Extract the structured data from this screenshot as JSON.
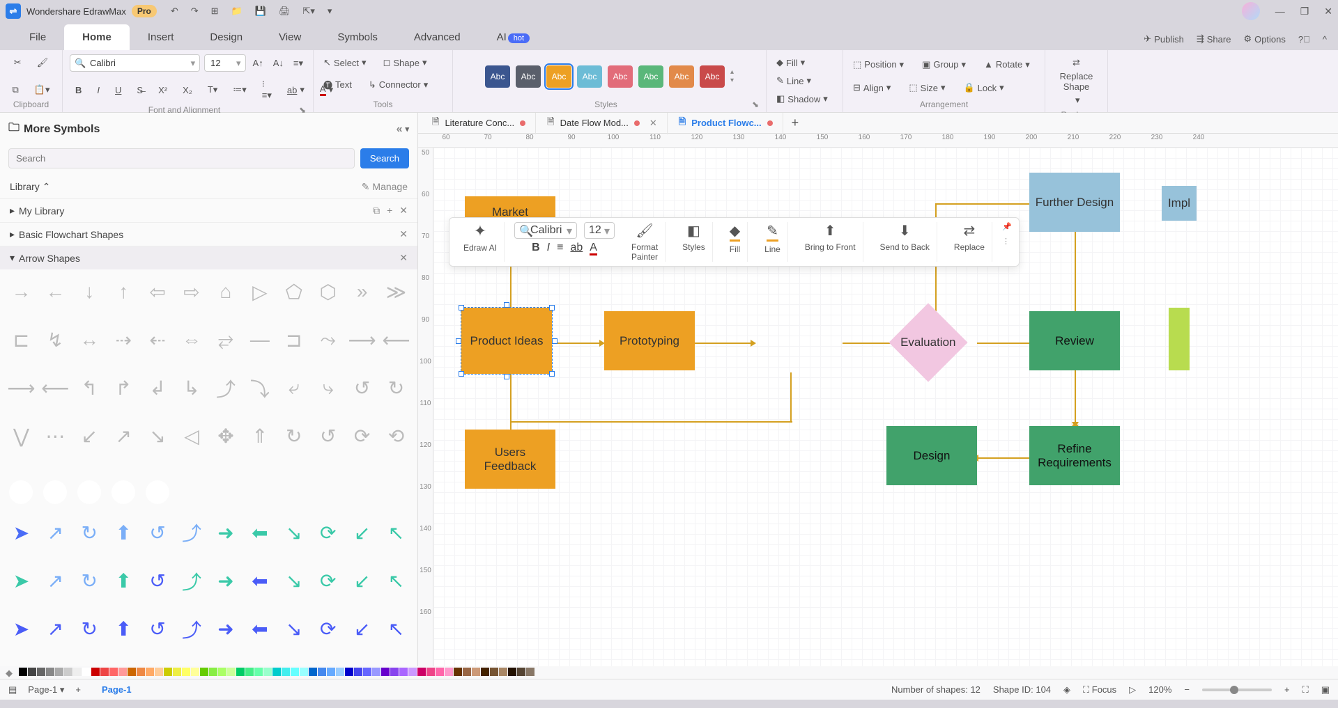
{
  "app": {
    "title": "Wondershare EdrawMax",
    "badge": "Pro"
  },
  "menu": {
    "items": [
      "File",
      "Home",
      "Insert",
      "Design",
      "View",
      "Symbols",
      "Advanced"
    ],
    "ai": "AI",
    "hot": "hot",
    "right": {
      "publish": "Publish",
      "share": "Share",
      "options": "Options"
    }
  },
  "ribbon": {
    "font": {
      "name": "Calibri",
      "size": "12"
    },
    "tools": {
      "select": "Select",
      "text": "Text",
      "shape": "Shape",
      "connector": "Connector"
    },
    "styles_swatches": [
      {
        "bg": "#3b568f",
        "txt": "Abc"
      },
      {
        "bg": "#5a5f6b",
        "txt": "Abc"
      },
      {
        "bg": "#eda023",
        "txt": "Abc",
        "sel": true
      },
      {
        "bg": "#6cbcd6",
        "txt": "Abc"
      },
      {
        "bg": "#e26c7a",
        "txt": "Abc"
      },
      {
        "bg": "#5ab77a",
        "txt": "Abc"
      },
      {
        "bg": "#e28a4a",
        "txt": "Abc"
      },
      {
        "bg": "#c94a4a",
        "txt": "Abc"
      }
    ],
    "shape_fmt": {
      "fill": "Fill",
      "line": "Line",
      "shadow": "Shadow"
    },
    "arrange": {
      "position": "Position",
      "align": "Align",
      "group": "Group",
      "size": "Size",
      "rotate": "Rotate",
      "lock": "Lock"
    },
    "replace": "Replace\nShape",
    "groups": {
      "clipboard": "Clipboard",
      "font": "Font and Alignment",
      "tools": "Tools",
      "styles": "Styles",
      "arrange": "Arrangement",
      "replace": "Replace"
    }
  },
  "side": {
    "title": "More Symbols",
    "search_ph": "Search",
    "search_btn": "Search",
    "library": "Library",
    "manage": "Manage",
    "cats": {
      "mylib": "My Library",
      "basic": "Basic Flowchart Shapes",
      "arrow": "Arrow Shapes"
    }
  },
  "tabs": [
    {
      "label": "Literature Conc...",
      "dirty": true,
      "active": false
    },
    {
      "label": "Date Flow Mod...",
      "dirty": true,
      "active": false,
      "closable": true
    },
    {
      "label": "Product Flowc...",
      "dirty": true,
      "active": true
    }
  ],
  "ruler_h": [
    "60",
    "70",
    "80",
    "90",
    "100",
    "110",
    "120",
    "130",
    "140",
    "150",
    "160",
    "170",
    "180",
    "190",
    "200",
    "210",
    "220",
    "230",
    "240"
  ],
  "ruler_v": [
    "50",
    "60",
    "70",
    "80",
    "90",
    "100",
    "110",
    "120",
    "130",
    "140",
    "150",
    "160"
  ],
  "nodes": {
    "market": "Market",
    "product_ideas": "Product Ideas",
    "prototyping": "Prototyping",
    "evaluation": "Evaluation",
    "review": "Review",
    "further_design": "Further Design",
    "impl": "Impl",
    "users_feedback": "Users\nFeedback",
    "design": "Design",
    "refine": "Refine\nRequirements"
  },
  "float": {
    "font": "Calibri",
    "size": "12",
    "ai": "Edraw AI",
    "format_painter": "Format\nPainter",
    "styles": "Styles",
    "fill": "Fill",
    "line": "Line",
    "btf": "Bring to Front",
    "stb": "Send to Back",
    "replace": "Replace"
  },
  "status": {
    "page_sel": "Page-1",
    "active_page": "Page-1",
    "shapes": "Number of shapes: 12",
    "shape_id": "Shape ID: 104",
    "focus": "Focus",
    "zoom": "120%"
  },
  "palette": [
    "#000",
    "#444",
    "#666",
    "#888",
    "#aaa",
    "#ccc",
    "#eee",
    "#fff",
    "#c00",
    "#e44",
    "#f66",
    "#f99",
    "#c60",
    "#e84",
    "#fa6",
    "#fc9",
    "#cc0",
    "#ee4",
    "#ff6",
    "#ff9",
    "#6c0",
    "#8e4",
    "#af6",
    "#cf9",
    "#0c6",
    "#4e8",
    "#6fa",
    "#9fc",
    "#0cc",
    "#4ee",
    "#6ff",
    "#9ff",
    "#06c",
    "#48e",
    "#6af",
    "#9cf",
    "#00c",
    "#44e",
    "#66f",
    "#99f",
    "#60c",
    "#84e",
    "#a6f",
    "#c9f",
    "#c06",
    "#e48",
    "#f6a",
    "#f9c",
    "#630",
    "#964",
    "#c97",
    "#420",
    "#753",
    "#a86",
    "#210",
    "#543",
    "#876"
  ]
}
